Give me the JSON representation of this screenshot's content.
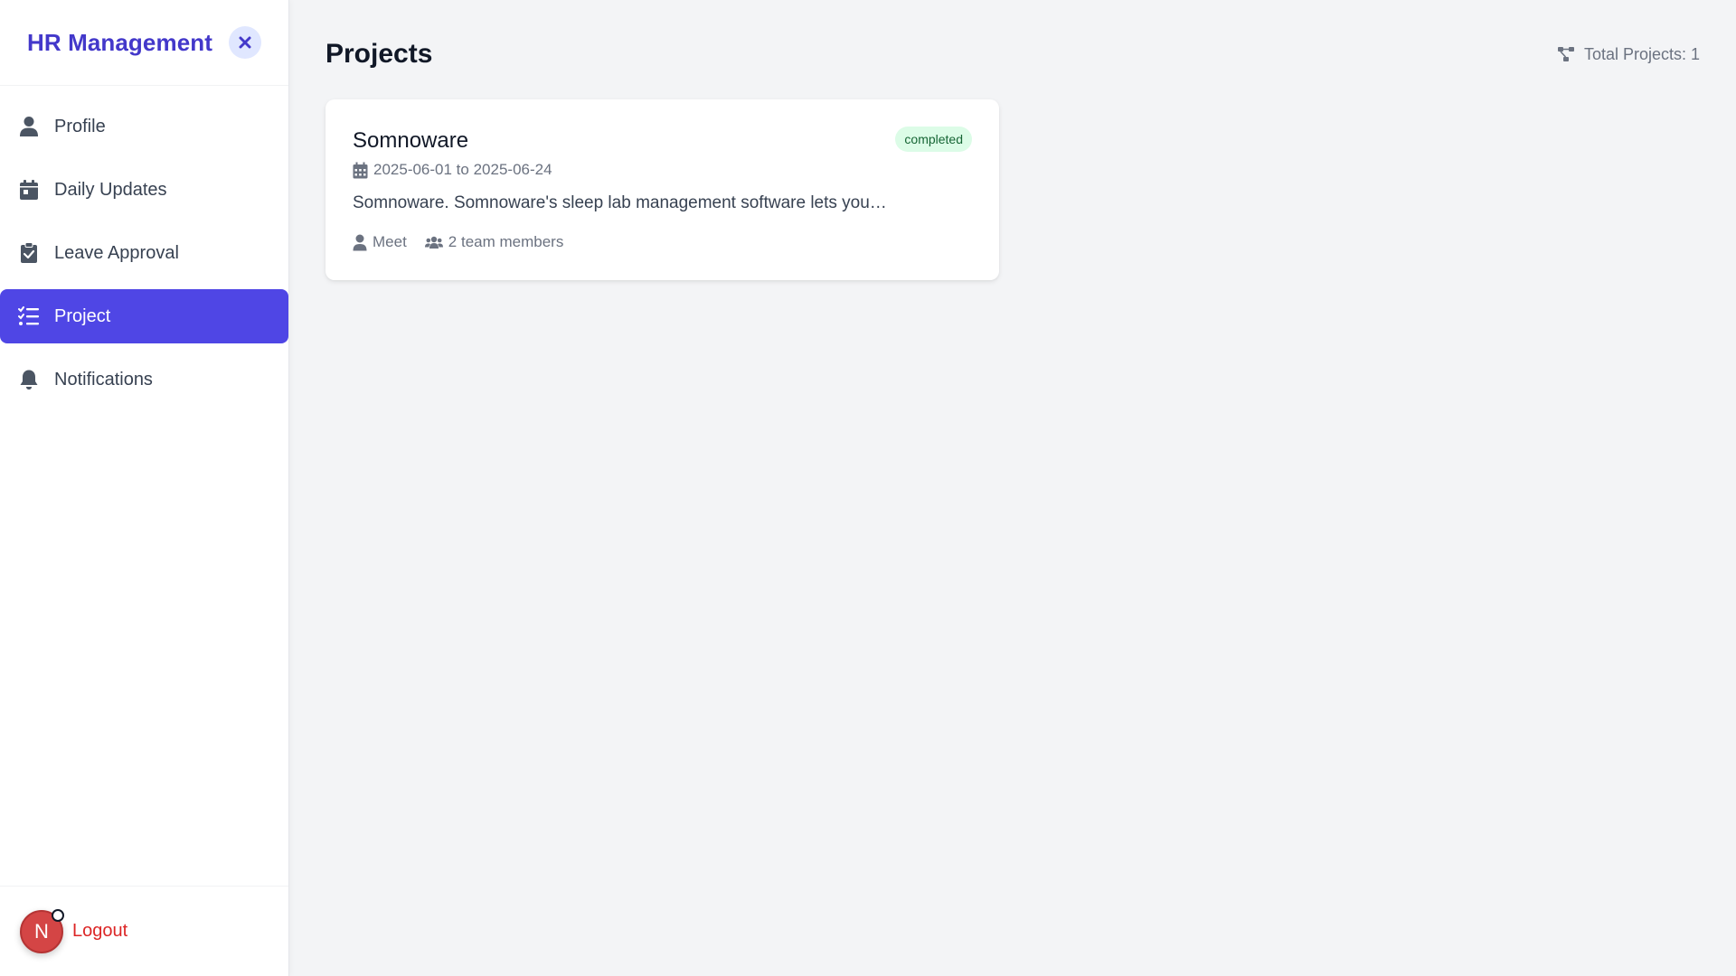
{
  "sidebar": {
    "brand": "HR Management",
    "items": [
      {
        "label": "Profile",
        "icon": "user-icon",
        "active": false
      },
      {
        "label": "Daily Updates",
        "icon": "calendar-icon",
        "active": false
      },
      {
        "label": "Leave Approval",
        "icon": "clipboard-check-icon",
        "active": false
      },
      {
        "label": "Project",
        "icon": "list-check-icon",
        "active": true
      },
      {
        "label": "Notifications",
        "icon": "bell-icon",
        "active": false
      }
    ],
    "avatar_initial": "N",
    "logout_label": "Logout"
  },
  "main": {
    "title": "Projects",
    "total_label": "Total Projects: 1",
    "projects": [
      {
        "name": "Somnoware",
        "status": "completed",
        "dates": "2025-06-01 to 2025-06-24",
        "description": "Somnoware. Somnoware's sleep lab management software lets you…",
        "owner": "Meet",
        "team": "2 team members"
      }
    ]
  },
  "colors": {
    "accent": "#4f46e5",
    "brand": "#4338ca",
    "logout": "#dc2626",
    "status_completed_bg": "#dcfce7",
    "avatar_bg": "#d44545"
  }
}
